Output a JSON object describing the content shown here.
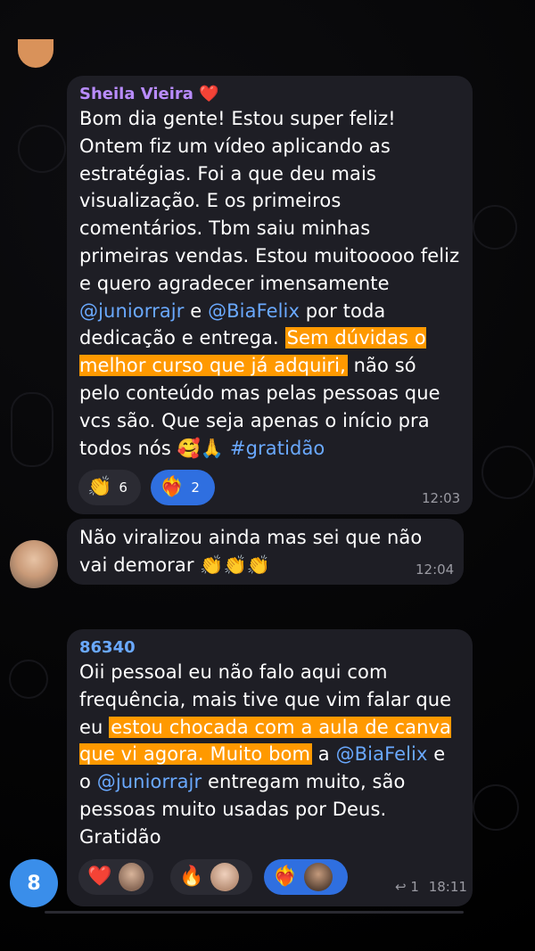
{
  "colors": {
    "accent": "#2f6fe0",
    "mention": "#6aa9ff",
    "highlight": "#ff9900",
    "bubble": "#1e1e25"
  },
  "messages": [
    {
      "sender": "Sheila Vieira",
      "sender_emoji": "❤️",
      "text_a": "Bom dia gente! Estou super feliz! Ontem fiz um vídeo aplicando as estratégias. Foi a que deu mais visualização. E os primeiros comentários. Tbm saiu minhas primeiras vendas.  Estou muitooooo feliz e quero agradecer imensamente ",
      "mention_1": "@juniorrajr",
      "text_b": " e ",
      "mention_2": "@BiaFelix",
      "text_c": " por toda dedicação e entrega. ",
      "highlight": " Sem dúvidas o melhor curso que já adquiri,",
      "text_d": " não só pelo conteúdo mas pelas pessoas que vcs são. Que seja apenas o início pra todos nós 🥰🙏 ",
      "hashtag": "#gratidão",
      "reactions": [
        {
          "emoji": "👏",
          "count": "6"
        },
        {
          "emoji": "❤️‍🔥",
          "count": "2"
        }
      ],
      "time": "12:03"
    },
    {
      "text": "Não viralizou ainda mas sei que não vai demorar 👏👏👏",
      "time": "12:04"
    },
    {
      "sender": "86340",
      "text_a": "Oii pessoal eu não falo aqui com frequência, mais tive que vim falar que eu ",
      "highlight": "estou chocada com a aula de canva que vi agora. Muito bom",
      "text_b": " a ",
      "mention_1": "@BiaFelix",
      "text_c": " e o ",
      "mention_2": "@juniorrajr",
      "text_d": " entregam muito, são pessoas muito usadas por Deus. Gratidão",
      "reactions": [
        {
          "emoji": "❤️"
        },
        {
          "emoji": "🔥"
        },
        {
          "emoji": "❤️‍🔥"
        }
      ],
      "reply_count": "1",
      "time": "18:11"
    }
  ],
  "unread_badge": "8"
}
